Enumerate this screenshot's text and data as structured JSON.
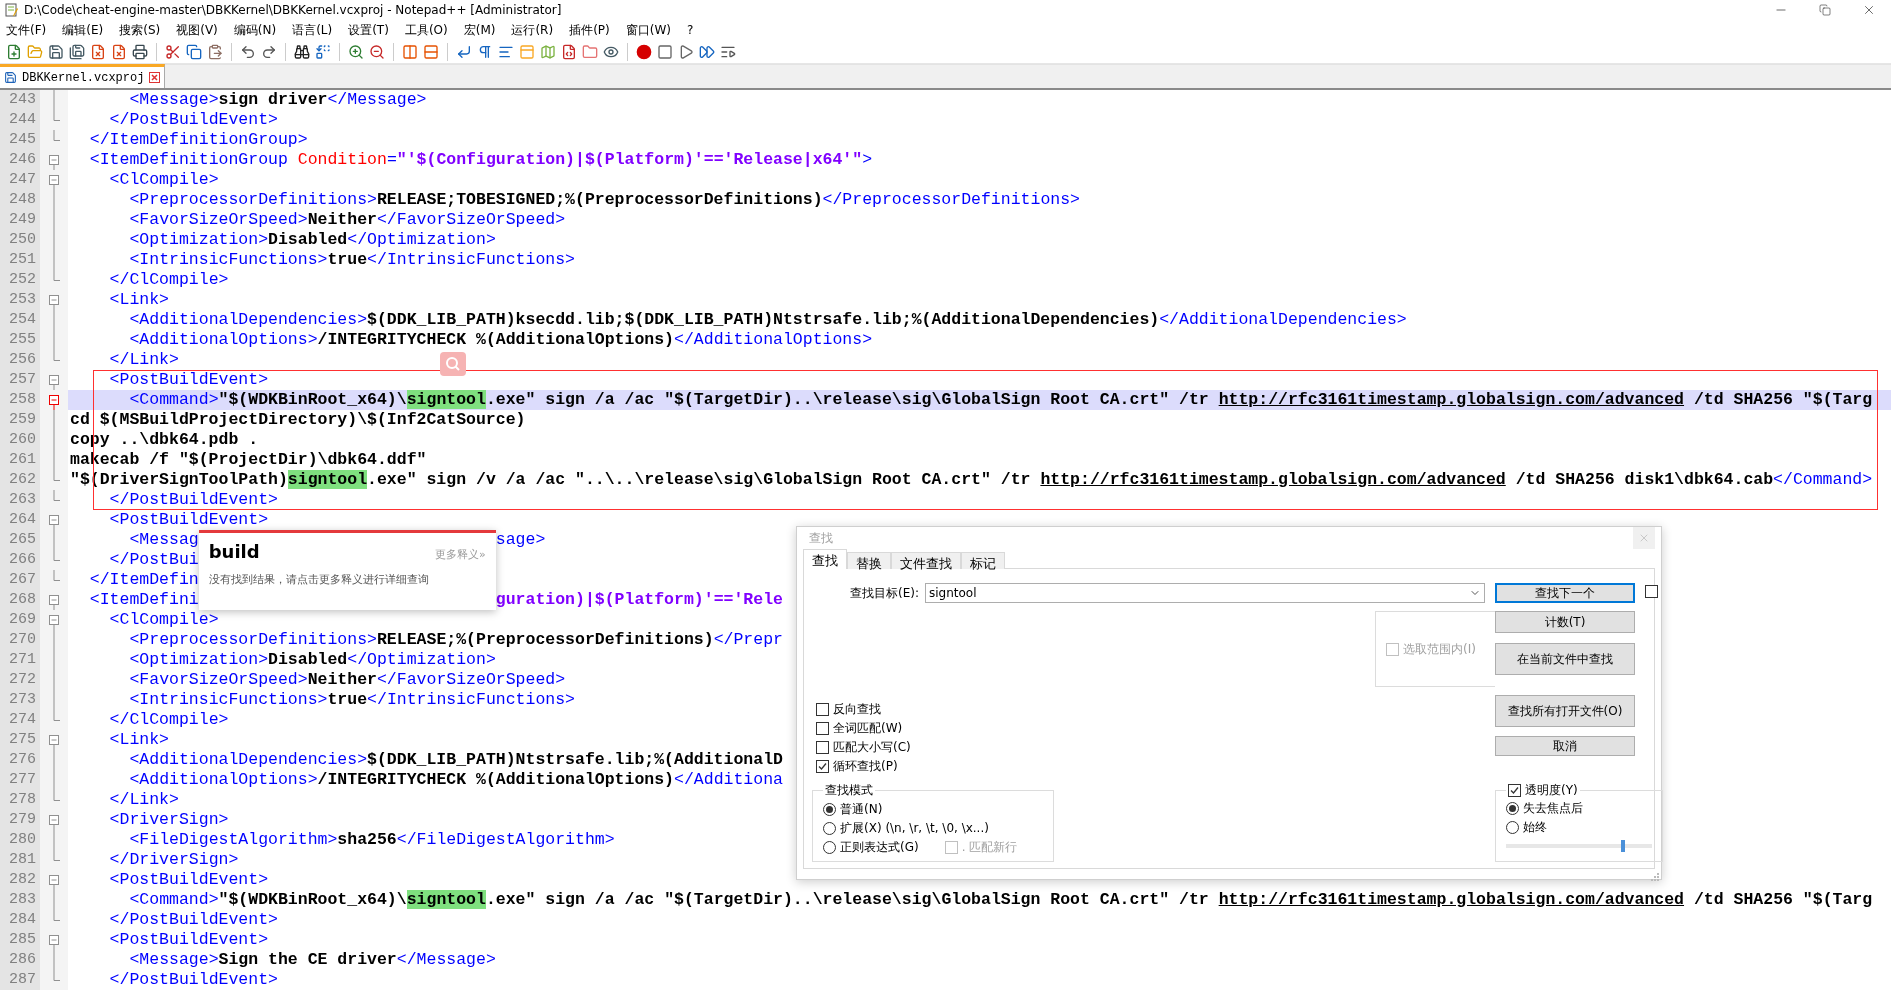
{
  "window": {
    "title": "D:\\Code\\cheat-engine-master\\DBKKernel\\DBKKernel.vcxproj - Notepad++ [Administrator]"
  },
  "menu": [
    "文件(F)",
    "编辑(E)",
    "搜索(S)",
    "视图(V)",
    "编码(N)",
    "语言(L)",
    "设置(T)",
    "工具(O)",
    "宏(M)",
    "运行(R)",
    "插件(P)",
    "窗口(W)",
    "?"
  ],
  "tabs": [
    {
      "label": "DBKKernel.vcxproj",
      "selected": true
    }
  ],
  "editor": {
    "lines": [
      {
        "number": "243",
        "kind": "fold-line",
        "current": false,
        "tokens": [
          {
            "kind": "tag",
            "text": "      <Message>"
          },
          {
            "kind": "text",
            "text": "sign driver"
          },
          {
            "kind": "tag",
            "text": "</Message>"
          }
        ]
      },
      {
        "number": "244",
        "kind": "fold-end",
        "current": false,
        "tokens": [
          {
            "kind": "tag",
            "text": "    </PostBuildEvent>"
          }
        ]
      },
      {
        "number": "245",
        "kind": "fold-end",
        "current": false,
        "tokens": [
          {
            "kind": "tag",
            "text": "  </ItemDefinitionGroup>"
          }
        ]
      },
      {
        "number": "246",
        "kind": "fold-start",
        "current": false,
        "tokens": [
          {
            "kind": "tag",
            "text": "  <ItemDefinitionGroup"
          },
          {
            "kind": "attr",
            "text": " Condition"
          },
          {
            "kind": "tag",
            "text": "="
          },
          {
            "kind": "value",
            "text": "\"'$(Configuration)|$(Platform)'=='Release|x64'\""
          },
          {
            "kind": "tag",
            "text": ">"
          }
        ]
      },
      {
        "number": "247",
        "kind": "fold-start",
        "current": false,
        "tokens": [
          {
            "kind": "tag",
            "text": "    <ClCompile>"
          }
        ]
      },
      {
        "number": "248",
        "kind": "fold-line",
        "current": false,
        "tokens": [
          {
            "kind": "tag",
            "text": "      <PreprocessorDefinitions>"
          },
          {
            "kind": "text",
            "text": "RELEASE;TOBESIGNED;%(PreprocessorDefinitions)"
          },
          {
            "kind": "tag",
            "text": "</PreprocessorDefinitions>"
          }
        ]
      },
      {
        "number": "249",
        "kind": "fold-line",
        "current": false,
        "tokens": [
          {
            "kind": "tag",
            "text": "      <FavorSizeOrSpeed>"
          },
          {
            "kind": "text",
            "text": "Neither"
          },
          {
            "kind": "tag",
            "text": "</FavorSizeOrSpeed>"
          }
        ]
      },
      {
        "number": "250",
        "kind": "fold-line",
        "current": false,
        "tokens": [
          {
            "kind": "tag",
            "text": "      <Optimization>"
          },
          {
            "kind": "text",
            "text": "Disabled"
          },
          {
            "kind": "tag",
            "text": "</Optimization>"
          }
        ]
      },
      {
        "number": "251",
        "kind": "fold-line",
        "current": false,
        "tokens": [
          {
            "kind": "tag",
            "text": "      <IntrinsicFunctions>"
          },
          {
            "kind": "text",
            "text": "true"
          },
          {
            "kind": "tag",
            "text": "</IntrinsicFunctions>"
          }
        ]
      },
      {
        "number": "252",
        "kind": "fold-end",
        "current": false,
        "tokens": [
          {
            "kind": "tag",
            "text": "    </ClCompile>"
          }
        ]
      },
      {
        "number": "253",
        "kind": "fold-start",
        "current": false,
        "tokens": [
          {
            "kind": "tag",
            "text": "    <Link>"
          }
        ]
      },
      {
        "number": "254",
        "kind": "fold-line",
        "current": false,
        "tokens": [
          {
            "kind": "tag",
            "text": "      <AdditionalDependencies>"
          },
          {
            "kind": "text",
            "text": "$(DDK_LIB_PATH)ksecdd.lib;$(DDK_LIB_PATH)Ntstrsafe.lib;%(AdditionalDependencies)"
          },
          {
            "kind": "tag",
            "text": "</AdditionalDependencies>"
          }
        ]
      },
      {
        "number": "255",
        "kind": "fold-line",
        "current": false,
        "tokens": [
          {
            "kind": "tag",
            "text": "      <AdditionalOptions>"
          },
          {
            "kind": "text",
            "text": "/INTEGRITYCHECK %(AdditionalOptions)"
          },
          {
            "kind": "tag",
            "text": "</AdditionalOptions>"
          }
        ]
      },
      {
        "number": "256",
        "kind": "fold-end",
        "current": false,
        "tokens": [
          {
            "kind": "tag",
            "text": "    </Link>"
          }
        ]
      },
      {
        "number": "257",
        "kind": "fold-start",
        "current": false,
        "tokens": [
          {
            "kind": "tag",
            "text": "    <PostBuildEvent>"
          }
        ]
      },
      {
        "number": "258",
        "kind": "fold-start",
        "current": true,
        "tokens": [
          {
            "kind": "tag",
            "text": "      <Command>"
          },
          {
            "kind": "text",
            "text": "\"$(WDKBinRoot_x64)\\"
          },
          {
            "kind": "match",
            "text": "signtool"
          },
          {
            "kind": "text",
            "text": ".exe\" sign /a /ac \"$(TargetDir)..\\release\\sig\\GlobalSign Root CA.crt\" /tr "
          },
          {
            "kind": "link",
            "text": "http://rfc3161timestamp.globalsign.com/advanced"
          },
          {
            "kind": "text",
            "text": " /td SHA256 \"$(Targ"
          }
        ]
      },
      {
        "number": "259",
        "kind": "fold-line",
        "current": false,
        "tokens": [
          {
            "kind": "text",
            "text": "cd $(MSBuildProjectDirectory)\\$(Inf2CatSource)"
          }
        ]
      },
      {
        "number": "260",
        "kind": "fold-line",
        "current": false,
        "tokens": [
          {
            "kind": "text",
            "text": "copy ..\\dbk64.pdb ."
          }
        ]
      },
      {
        "number": "261",
        "kind": "fold-line",
        "current": false,
        "tokens": [
          {
            "kind": "text",
            "text": "makecab /f \"$(ProjectDir)\\dbk64.ddf\""
          }
        ]
      },
      {
        "number": "262",
        "kind": "fold-end",
        "current": false,
        "tokens": [
          {
            "kind": "text",
            "text": "\"$(DriverSignToolPath)"
          },
          {
            "kind": "match",
            "text": "signtool"
          },
          {
            "kind": "text",
            "text": ".exe\" sign /v /a /ac \"..\\..\\release\\sig\\GlobalSign Root CA.crt\" /tr "
          },
          {
            "kind": "link",
            "text": "http://rfc3161timestamp.globalsign.com/advanced"
          },
          {
            "kind": "text",
            "text": " /td SHA256 disk1\\dbk64.cab"
          },
          {
            "kind": "tag",
            "text": "</Command>"
          }
        ]
      },
      {
        "number": "263",
        "kind": "fold-end",
        "current": false,
        "tokens": [
          {
            "kind": "tag",
            "text": "    </PostBuildEvent>"
          }
        ]
      },
      {
        "number": "264",
        "kind": "fold-start",
        "current": false,
        "tokens": [
          {
            "kind": "tag",
            "text": "    <PostBuildEvent>"
          }
        ]
      },
      {
        "number": "265",
        "kind": "fold-line",
        "current": false,
        "tokens": [
          {
            "kind": "tag",
            "text": "      <Messag"
          },
          {
            "kind": "tag",
            "text": "                              sage>"
          }
        ]
      },
      {
        "number": "266",
        "kind": "fold-end",
        "current": false,
        "tokens": [
          {
            "kind": "tag",
            "text": "    </PostBui"
          }
        ]
      },
      {
        "number": "267",
        "kind": "fold-end",
        "current": false,
        "tokens": [
          {
            "kind": "tag",
            "text": "  </ItemDefin"
          }
        ]
      },
      {
        "number": "268",
        "kind": "fold-start",
        "current": false,
        "tokens": [
          {
            "kind": "tag",
            "text": "  <ItemDefini"
          },
          {
            "kind": "value",
            "text": "                              guration)|$(Platform)'=='Rele"
          }
        ]
      },
      {
        "number": "269",
        "kind": "fold-start",
        "current": false,
        "tokens": [
          {
            "kind": "tag",
            "text": "    <ClCompile>"
          }
        ]
      },
      {
        "number": "270",
        "kind": "fold-line",
        "current": false,
        "tokens": [
          {
            "kind": "tag",
            "text": "      <PreprocessorDefinitions>"
          },
          {
            "kind": "text",
            "text": "RELEASE;%(PreprocessorDefinitions)"
          },
          {
            "kind": "tag",
            "text": "</Prepr"
          }
        ]
      },
      {
        "number": "271",
        "kind": "fold-line",
        "current": false,
        "tokens": [
          {
            "kind": "tag",
            "text": "      <Optimization>"
          },
          {
            "kind": "text",
            "text": "Disabled"
          },
          {
            "kind": "tag",
            "text": "</Optimization>"
          }
        ]
      },
      {
        "number": "272",
        "kind": "fold-line",
        "current": false,
        "tokens": [
          {
            "kind": "tag",
            "text": "      <FavorSizeOrSpeed>"
          },
          {
            "kind": "text",
            "text": "Neither"
          },
          {
            "kind": "tag",
            "text": "</FavorSizeOrSpeed>"
          }
        ]
      },
      {
        "number": "273",
        "kind": "fold-line",
        "current": false,
        "tokens": [
          {
            "kind": "tag",
            "text": "      <IntrinsicFunctions>"
          },
          {
            "kind": "text",
            "text": "true"
          },
          {
            "kind": "tag",
            "text": "</IntrinsicFunctions>"
          }
        ]
      },
      {
        "number": "274",
        "kind": "fold-end",
        "current": false,
        "tokens": [
          {
            "kind": "tag",
            "text": "    </ClCompile>"
          }
        ]
      },
      {
        "number": "275",
        "kind": "fold-start",
        "current": false,
        "tokens": [
          {
            "kind": "tag",
            "text": "    <Link>"
          }
        ]
      },
      {
        "number": "276",
        "kind": "fold-line",
        "current": false,
        "tokens": [
          {
            "kind": "tag",
            "text": "      <AdditionalDependencies>"
          },
          {
            "kind": "text",
            "text": "$(DDK_LIB_PATH)Ntstrsafe.lib;%(AdditionalD"
          }
        ]
      },
      {
        "number": "277",
        "kind": "fold-line",
        "current": false,
        "tokens": [
          {
            "kind": "tag",
            "text": "      <AdditionalOptions>"
          },
          {
            "kind": "text",
            "text": "/INTEGRITYCHECK %(AdditionalOptions)"
          },
          {
            "kind": "tag",
            "text": "</Additiona"
          }
        ]
      },
      {
        "number": "278",
        "kind": "fold-end",
        "current": false,
        "tokens": [
          {
            "kind": "tag",
            "text": "    </Link>"
          }
        ]
      },
      {
        "number": "279",
        "kind": "fold-start",
        "current": false,
        "tokens": [
          {
            "kind": "tag",
            "text": "    <DriverSign>"
          }
        ]
      },
      {
        "number": "280",
        "kind": "fold-line",
        "current": false,
        "tokens": [
          {
            "kind": "tag",
            "text": "      <FileDigestAlgorithm>"
          },
          {
            "kind": "text",
            "text": "sha256"
          },
          {
            "kind": "tag",
            "text": "</FileDigestAlgorithm>"
          }
        ]
      },
      {
        "number": "281",
        "kind": "fold-end",
        "current": false,
        "tokens": [
          {
            "kind": "tag",
            "text": "    </DriverSign>"
          }
        ]
      },
      {
        "number": "282",
        "kind": "fold-start",
        "current": false,
        "tokens": [
          {
            "kind": "tag",
            "text": "    <PostBuildEvent>"
          }
        ]
      },
      {
        "number": "283",
        "kind": "fold-line",
        "current": false,
        "tokens": [
          {
            "kind": "tag",
            "text": "      <Command>"
          },
          {
            "kind": "text",
            "text": "\"$(WDKBinRoot_x64)\\"
          },
          {
            "kind": "match",
            "text": "signtool"
          },
          {
            "kind": "text",
            "text": ".exe\" sign /a /ac \"$(TargetDir)..\\release\\sig\\GlobalSign Root CA.crt\" /tr "
          },
          {
            "kind": "link",
            "text": "http://rfc3161timestamp.globalsign.com/advanced"
          },
          {
            "kind": "text",
            "text": " /td SHA256 \"$(Targ"
          }
        ]
      },
      {
        "number": "284",
        "kind": "fold-end",
        "current": false,
        "tokens": [
          {
            "kind": "tag",
            "text": "    </PostBuildEvent>"
          }
        ]
      },
      {
        "number": "285",
        "kind": "fold-start",
        "current": false,
        "tokens": [
          {
            "kind": "tag",
            "text": "    <PostBuildEvent>"
          }
        ]
      },
      {
        "number": "286",
        "kind": "fold-line",
        "current": false,
        "tokens": [
          {
            "kind": "tag",
            "text": "      <Message>"
          },
          {
            "kind": "text",
            "text": "Sign the CE driver"
          },
          {
            "kind": "tag",
            "text": "</Message>"
          }
        ]
      },
      {
        "number": "287",
        "kind": "fold-end",
        "current": false,
        "tokens": [
          {
            "kind": "tag",
            "text": "    </PostBuildEvent>"
          }
        ]
      }
    ]
  },
  "dictionary_popup": {
    "word": "build",
    "more": "更多释义»",
    "message": "没有找到结果，请点击更多释义进行详细查询"
  },
  "find_dialog": {
    "title": "查找",
    "tabs": [
      {
        "label": "查找",
        "selected": true
      },
      {
        "label": "替换",
        "selected": false
      },
      {
        "label": "文件查找",
        "selected": false
      },
      {
        "label": "标记",
        "selected": false
      }
    ],
    "find_label": "查找目标(E):",
    "find_value": "signtool",
    "extra_checkbox": {
      "checked": false
    },
    "buttons": [
      {
        "label": "查找下一个",
        "focused": true
      },
      {
        "label": "计数(T)",
        "focused": false
      },
      {
        "label": "在当前文件中查找",
        "focused": false
      },
      {
        "label": "查找所有打开文件(O)",
        "focused": false
      },
      {
        "label": "取消",
        "focused": false
      }
    ],
    "in_selection": {
      "label": "选取范围内(I)",
      "checked": false,
      "disabled": true
    },
    "options": [
      {
        "label": "反向查找",
        "checked": false
      },
      {
        "label": "全词匹配(W)",
        "checked": false
      },
      {
        "label": "匹配大小写(C)",
        "checked": false
      },
      {
        "label": "循环查找(P)",
        "checked": true
      }
    ],
    "search_mode": {
      "title": "查找模式",
      "options": [
        {
          "label": "普通(N)",
          "selected": true
        },
        {
          "label": "扩展(X) (\\n, \\r, \\t, \\0, \\x...)",
          "selected": false
        },
        {
          "label": "正则表达式(G)",
          "selected": false
        }
      ],
      "newline": {
        "label": ". 匹配新行",
        "checked": false,
        "disabled": true
      }
    },
    "transparency": {
      "label": "透明度(Y)",
      "checked": true,
      "options": [
        {
          "label": "失去焦点后",
          "selected": true
        },
        {
          "label": "始终",
          "selected": false
        }
      ],
      "level": 0.8
    }
  }
}
